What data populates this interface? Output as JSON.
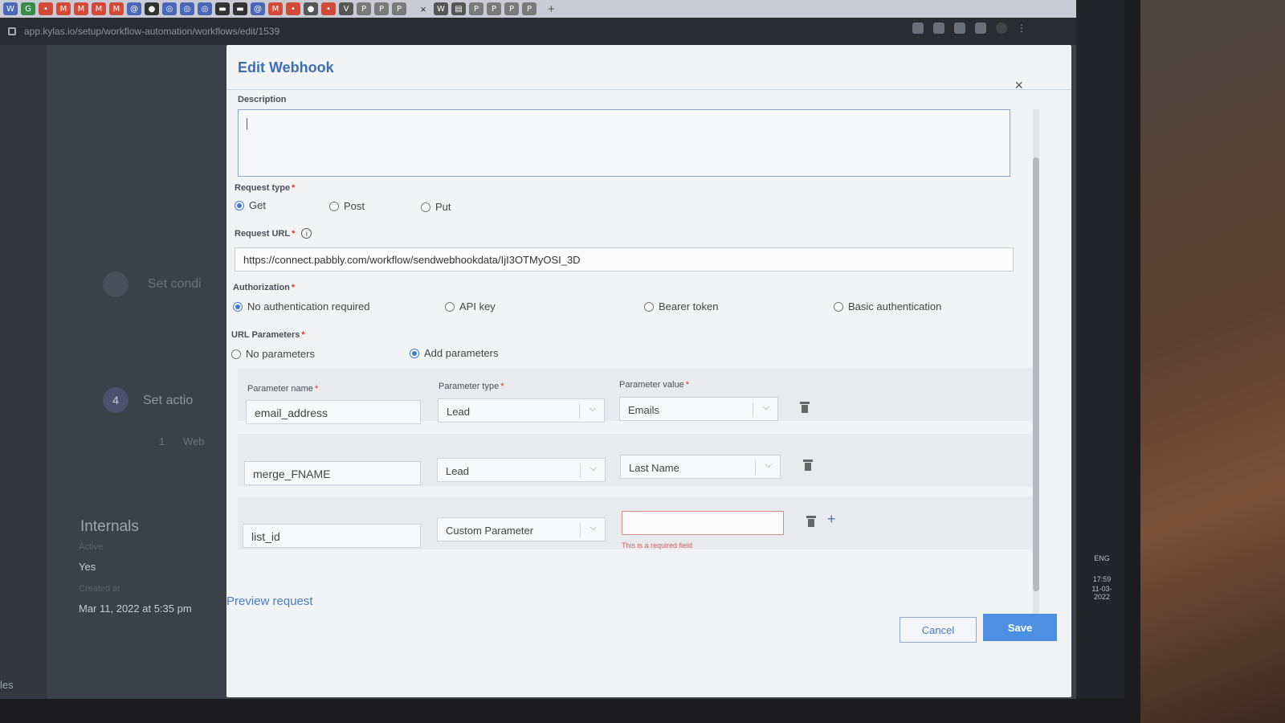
{
  "browser": {
    "url": "app.kylas.io/setup/workflow-automation/workflows/edit/1539",
    "tabs": [
      {
        "icon": "W",
        "color": "#4a67b8"
      },
      {
        "icon": "G",
        "color": "#3a8a4a"
      },
      {
        "icon": "•",
        "color": "#d24b3a"
      },
      {
        "icon": "M",
        "color": "#d24b3a"
      },
      {
        "icon": "M",
        "color": "#d24b3a"
      },
      {
        "icon": "M",
        "color": "#d24b3a"
      },
      {
        "icon": "M",
        "color": "#d24b3a"
      },
      {
        "icon": "@",
        "color": "#4a67b8"
      },
      {
        "icon": "●",
        "color": "#333333"
      },
      {
        "icon": "◎",
        "color": "#4a67b8"
      },
      {
        "icon": "◎",
        "color": "#4a67b8"
      },
      {
        "icon": "◎",
        "color": "#4a67b8"
      },
      {
        "icon": "▬",
        "color": "#333333"
      },
      {
        "icon": "▬",
        "color": "#333333"
      },
      {
        "icon": "@",
        "color": "#4a67b8"
      },
      {
        "icon": "M",
        "color": "#d24b3a"
      },
      {
        "icon": "•",
        "color": "#d24b3a"
      },
      {
        "icon": "●",
        "color": "#555555"
      },
      {
        "icon": "•",
        "color": "#d24b3a"
      },
      {
        "icon": "V",
        "color": "#555555"
      },
      {
        "icon": "P",
        "color": "#7a7a7a"
      },
      {
        "icon": "P",
        "color": "#7a7a7a"
      },
      {
        "icon": "P",
        "color": "#7a7a7a"
      }
    ],
    "active_tab_close": "×",
    "right_tabs": [
      {
        "icon": "W",
        "color": "#555555"
      },
      {
        "icon": "▤",
        "color": "#555555"
      },
      {
        "icon": "P",
        "color": "#7a7a7a"
      },
      {
        "icon": "P",
        "color": "#7a7a7a"
      },
      {
        "icon": "P",
        "color": "#7a7a7a"
      },
      {
        "icon": "P",
        "color": "#7a7a7a"
      }
    ],
    "new_tab": "+"
  },
  "background": {
    "step3_label": "Set condi",
    "step4_number": "4",
    "step4_label": "Set actio",
    "row_number": "1",
    "row_text": "Web",
    "internals_title": "Internals",
    "active_label": "Active",
    "active_value": "Yes",
    "created_label": "Created at",
    "created_value": "Mar 11, 2022 at 5:35 pm",
    "bottom_left": "les"
  },
  "taskbar": {
    "lang": "ENG",
    "time": "17:59",
    "date": "11-03-2022"
  },
  "modal": {
    "title": "Edit Webhook",
    "close": "×",
    "description_label": "Description",
    "description_value": "",
    "request_type_label": "Request type",
    "request_types": [
      "Get",
      "Post",
      "Put"
    ],
    "request_type_selected": "Get",
    "request_url_label": "Request URL",
    "request_url_value": "https://connect.pabbly.com/workflow/sendwebhookdata/IjI3OTMyOSI_3D",
    "auth_label": "Authorization",
    "auth_options": [
      "No authentication required",
      "API key",
      "Bearer token",
      "Basic authentication"
    ],
    "auth_selected": "No authentication required",
    "url_params_label": "URL Parameters",
    "url_params_options": [
      "No parameters",
      "Add parameters"
    ],
    "url_params_selected": "Add parameters",
    "param_headers": {
      "name": "Parameter name",
      "type": "Parameter type",
      "value": "Parameter value"
    },
    "params": [
      {
        "name": "email_address",
        "type": "Lead",
        "value": "Emails"
      },
      {
        "name": "merge_FNAME",
        "type": "Lead",
        "value": "Last Name"
      },
      {
        "name": "list_id",
        "type": "Custom Parameter",
        "value": ""
      }
    ],
    "required_error": "This is a required field",
    "preview_link": "Preview request",
    "cancel": "Cancel",
    "save": "Save",
    "required_marker": "*"
  }
}
